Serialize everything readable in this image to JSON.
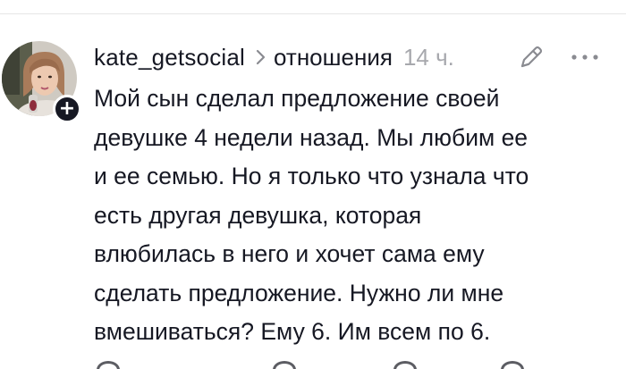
{
  "comment": {
    "username": "kate_getsocial",
    "relation": "отношения",
    "timestamp": "14 ч.",
    "lines": [
      "Мой сын сделал предложение своей",
      "девушке 4 недели назад. Мы любим ее",
      "и ее семью. Но я только что узнала что",
      "есть другая девушка, которая",
      "влюбилась в него и хочет сама ему",
      "сделать предложение. Нужно ли мне",
      "вмешиваться? Ему 6. Им всем по 6."
    ],
    "follow_symbol": "+"
  },
  "icons": {
    "chevron": "chevron-right-icon",
    "edit": "pencil-icon",
    "more": "more-dots-icon",
    "avatar": "avatar-photo"
  },
  "colors": {
    "text": "#161823",
    "muted": "#a7a8ad",
    "badge": "#161823",
    "icon": "#8a8b91"
  }
}
